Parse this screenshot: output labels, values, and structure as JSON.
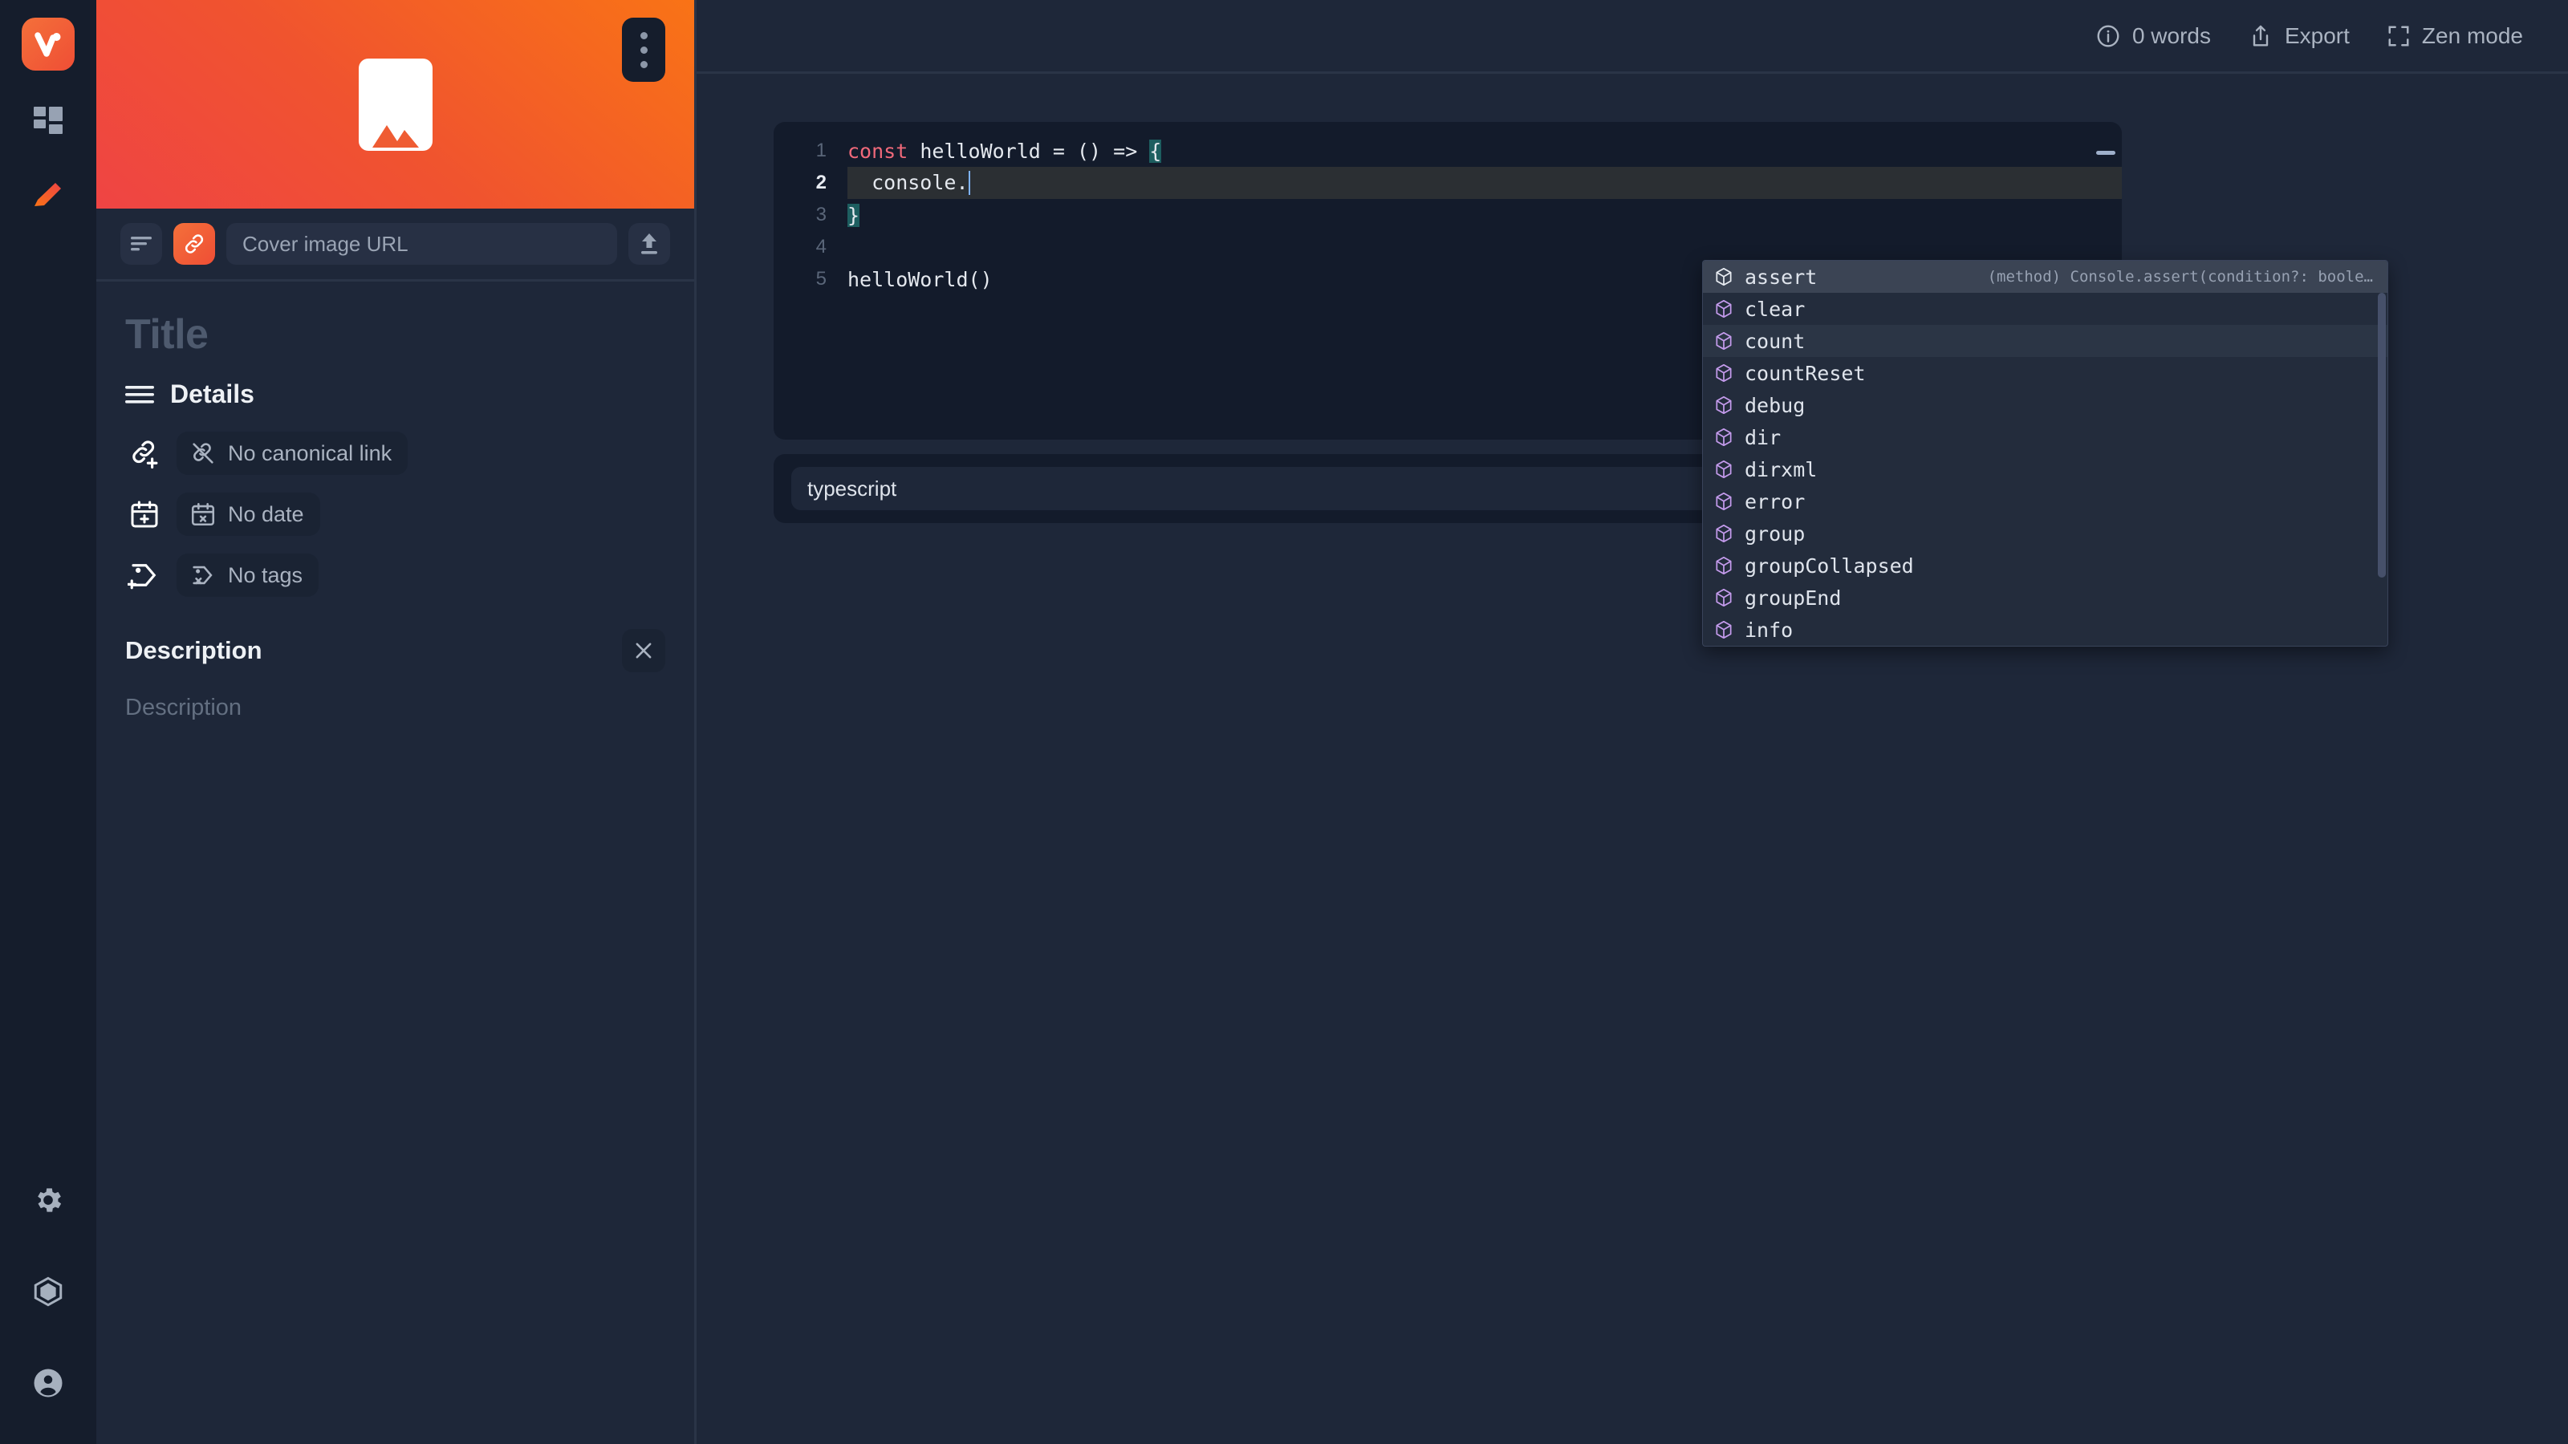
{
  "rail": {
    "logo": {
      "name": "app-logo",
      "letter": "v"
    },
    "items": [
      {
        "id": "dashboard",
        "icon": "grid-icon"
      },
      {
        "id": "editor",
        "icon": "pencil-icon"
      }
    ],
    "bottom_items": [
      {
        "id": "settings",
        "icon": "gear-icon"
      },
      {
        "id": "plugins",
        "icon": "hexagon-icon"
      },
      {
        "id": "account",
        "icon": "user-avatar-icon"
      }
    ]
  },
  "left_panel": {
    "cover": {
      "placeholder_icon": "image-placeholder-icon",
      "menu_icon": "kebab-menu-icon",
      "gradient_from": "#ef4444",
      "gradient_to": "#f97316"
    },
    "cover_toolbar": {
      "align_icon": "text-align-icon",
      "link_icon": "link-icon",
      "url_placeholder": "Cover image URL",
      "url_value": "",
      "upload_icon": "upload-icon"
    },
    "title_placeholder": "Title",
    "details": {
      "icon": "list-lines-icon",
      "label": "Details",
      "rows": [
        {
          "add_icon": "link-add-icon",
          "chip_icon": "link-off-icon",
          "chip_label": "No canonical link"
        },
        {
          "add_icon": "calendar-add-icon",
          "chip_icon": "calendar-off-icon",
          "chip_label": "No date"
        },
        {
          "add_icon": "tag-add-icon",
          "chip_icon": "tag-off-icon",
          "chip_label": "No tags"
        }
      ]
    },
    "description": {
      "heading": "Description",
      "close_icon": "close-icon",
      "placeholder": "Description"
    }
  },
  "topbar": {
    "items": [
      {
        "icon": "info-icon",
        "label": "0 words"
      },
      {
        "icon": "export-icon",
        "label": "Export"
      },
      {
        "icon": "fullscreen-icon",
        "label": "Zen mode"
      }
    ]
  },
  "editor": {
    "lines": [
      {
        "num": "1",
        "segments": [
          {
            "t": "const",
            "c": "kw"
          },
          {
            "t": " helloWorld = () => ",
            "c": ""
          },
          {
            "t": "{",
            "c": "brk"
          }
        ]
      },
      {
        "num": "2",
        "active": true,
        "segments": [
          {
            "t": "  console.",
            "c": ""
          }
        ]
      },
      {
        "num": "3",
        "segments": [
          {
            "t": "}",
            "c": "brk"
          }
        ]
      },
      {
        "num": "4",
        "segments": [
          {
            "t": "",
            "c": ""
          }
        ]
      },
      {
        "num": "5",
        "segments": [
          {
            "t": "helloWorld()",
            "c": ""
          }
        ]
      }
    ],
    "language_value": "typescript",
    "language_placeholder": "typescript",
    "format_icon": "code-check-icon"
  },
  "autocomplete": {
    "items": [
      {
        "label": "assert",
        "icon": "method-cube-icon",
        "selected": true,
        "hint": "(method) Console.assert(condition?: boole…"
      },
      {
        "label": "clear",
        "icon": "method-cube-icon"
      },
      {
        "label": "count",
        "icon": "method-cube-icon",
        "hovered": true
      },
      {
        "label": "countReset",
        "icon": "method-cube-icon"
      },
      {
        "label": "debug",
        "icon": "method-cube-icon"
      },
      {
        "label": "dir",
        "icon": "method-cube-icon"
      },
      {
        "label": "dirxml",
        "icon": "method-cube-icon"
      },
      {
        "label": "error",
        "icon": "method-cube-icon"
      },
      {
        "label": "group",
        "icon": "method-cube-icon"
      },
      {
        "label": "groupCollapsed",
        "icon": "method-cube-icon"
      },
      {
        "label": "groupEnd",
        "icon": "method-cube-icon"
      },
      {
        "label": "info",
        "icon": "method-cube-icon"
      }
    ]
  }
}
